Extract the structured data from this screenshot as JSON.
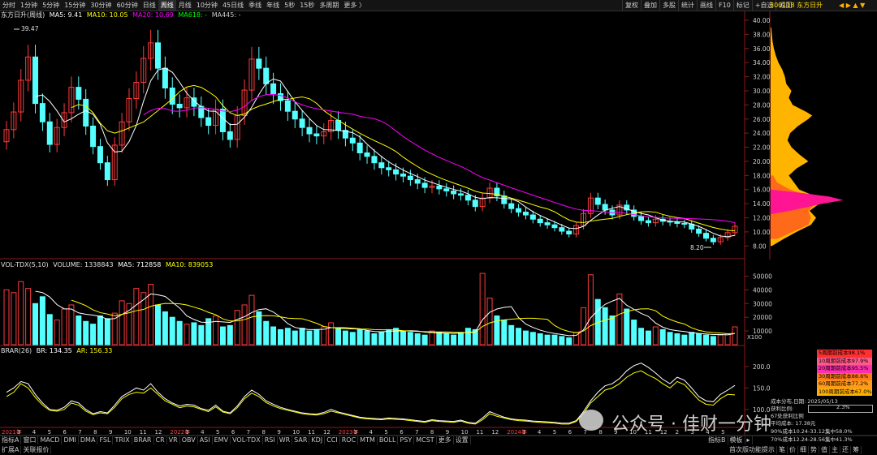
{
  "toolbar": {
    "tabs": [
      "分时",
      "1分钟",
      "5分钟",
      "15分钟",
      "30分钟",
      "60分钟",
      "日线",
      "周线",
      "月线",
      "10分钟",
      "45日线",
      "季线",
      "年线",
      "5秒",
      "15秒",
      "多周期",
      "更多 〉"
    ],
    "active_tab": "周线",
    "right_buttons": [
      "复权",
      "叠加",
      "多股",
      "统计",
      "画线",
      "F10",
      "标记",
      "+自选",
      "返回"
    ],
    "stock_code_name": "300118 东方日升"
  },
  "price_panel": {
    "label": "东方日升(周线)",
    "ma5": "MA5: 9.41",
    "ma10": "MA10: 10.05",
    "ma20": "MA20: 10.69",
    "ma618": "MA618: -",
    "ma445": "MA445: -",
    "high_label": "39.47",
    "low_label": "8.20",
    "y_ticks": [
      "40.00",
      "38.00",
      "36.00",
      "34.00",
      "32.00",
      "30.00",
      "28.00",
      "26.00",
      "24.00",
      "22.00",
      "20.00",
      "18.00",
      "16.00",
      "14.00",
      "12.00",
      "10.00",
      "8.00"
    ]
  },
  "volume_panel": {
    "label": "VOL-TDX(5,10)",
    "volume": "VOLUME: 1338843",
    "ma5": "MA5: 712858",
    "ma10": "MA10: 839053",
    "y_ticks": [
      "50000",
      "40000",
      "30000",
      "20000",
      "10000"
    ],
    "unit": "X100"
  },
  "brar_panel": {
    "label": "BRAR(26)",
    "br": "BR: 134.35",
    "ar": "AR: 156.33",
    "y_ticks": [
      "200.0",
      "150.0",
      "100.0"
    ]
  },
  "x_axis": {
    "labels": [
      "2021年",
      "3",
      "4",
      "5",
      "6",
      "7",
      "8",
      "9",
      "10",
      "11",
      "12",
      "2022年",
      "3",
      "4",
      "5",
      "6",
      "7",
      "8",
      "9",
      "10",
      "11",
      "12",
      "2023年",
      "3",
      "4",
      "5",
      "6",
      "7",
      "8",
      "9",
      "10",
      "11",
      "12",
      "2024年",
      "3",
      "4",
      "5",
      "6",
      "7",
      "8",
      "9",
      "10",
      "11",
      "12",
      "2",
      "3",
      "4",
      "5"
    ]
  },
  "indicator_tabs": [
    "指标A",
    "窗口",
    "MACD",
    "DMI",
    "DMA",
    "FSL",
    "TRIX",
    "BRAR",
    "CR",
    "VR",
    "OBV",
    "ASI",
    "EMV",
    "VOL-TDX",
    "RSI",
    "WR",
    "SAR",
    "KDJ",
    "CCI",
    "ROC",
    "MTM",
    "BOLL",
    "PSY",
    "MCST",
    "更多",
    "设置"
  ],
  "indicator_right": [
    "指标B",
    "模板",
    "▸"
  ],
  "bottom_bar": [
    "扩展A",
    "关联报价"
  ],
  "bottom_right": [
    "首次版功能提示",
    "笔",
    "价",
    "细",
    "势",
    "值",
    "主",
    "还",
    "筹"
  ],
  "cost_legend": [
    {
      "label": "5周期前成本98.1%",
      "color": "#ff3030"
    },
    {
      "label": "10周期前成本97.9%",
      "color": "#ff5a8a"
    },
    {
      "label": "20周期前成本95.5%",
      "color": "#ff2fb0"
    },
    {
      "label": "30周期前成本88.6%",
      "color": "#ff7a1a"
    },
    {
      "label": "60周期前成本77.2%",
      "color": "#ff9a1a"
    },
    {
      "label": "100周期前成本67.0%",
      "color": "#ffb000"
    }
  ],
  "chip_stats": {
    "line1": "成本分布,日期: 2025/05/13",
    "line2": "获利比例:",
    "line2_val": "2.3%",
    "line3": "67处获利比例",
    "line4": "平均成本: 17.38元",
    "line5": "90%成本10.24-33.12集中58.0%",
    "line6": "70%成本12.24-28.56集中41.3%"
  },
  "watermark": "公众号 · 佳财一分钟",
  "colors": {
    "up": "#ff3b3b",
    "down": "#54ffff",
    "ma5": "#ffffff",
    "ma10": "#ffff00",
    "ma20": "#ff00ff",
    "chip": "#ffb400"
  },
  "chart_data": {
    "type": "candlestick",
    "close": [
      24.5,
      27.0,
      31.5,
      34.8,
      28.2,
      25.6,
      22.4,
      24.8,
      26.9,
      30.5,
      28.8,
      25.0,
      22.1,
      19.8,
      17.4,
      22.3,
      25.6,
      28.9,
      31.2,
      34.6,
      36.8,
      33.2,
      30.4,
      28.1,
      27.6,
      29.0,
      27.8,
      26.2,
      25.1,
      27.4,
      24.2,
      23.1,
      26.5,
      30.1,
      34.5,
      33.2,
      31.0,
      29.6,
      28.6,
      27.1,
      26.0,
      24.8,
      23.9,
      23.6,
      24.2,
      25.8,
      24.4,
      23.3,
      22.6,
      21.2,
      20.7,
      19.8,
      19.1,
      18.8,
      18.2,
      17.9,
      17.4,
      16.9,
      16.3,
      16.5,
      16.1,
      15.8,
      15.4,
      15.2,
      14.5,
      13.6,
      14.8,
      16.2,
      15.1,
      14.0,
      13.3,
      12.8,
      12.4,
      11.8,
      11.3,
      11.0,
      10.6,
      10.1,
      9.7,
      10.9,
      12.6,
      14.8,
      13.9,
      13.1,
      12.4,
      13.8,
      13.1,
      12.2,
      11.6,
      11.3,
      11.8,
      11.5,
      11.4,
      11.2,
      11.1,
      10.4,
      9.8,
      9.1,
      8.6,
      9.2,
      9.9,
      10.8
    ],
    "volume": [
      40000,
      38000,
      46000,
      41000,
      30000,
      35000,
      22000,
      18000,
      26000,
      29000,
      21000,
      17000,
      15000,
      21000,
      19000,
      23000,
      32000,
      30000,
      41000,
      38000,
      44000,
      29000,
      24000,
      20000,
      17000,
      15000,
      16000,
      14000,
      19000,
      21000,
      13000,
      14000,
      25000,
      29000,
      36000,
      24000,
      17000,
      13000,
      11000,
      12000,
      10000,
      12000,
      10000,
      11000,
      13000,
      16000,
      12000,
      10000,
      9000,
      11000,
      10000,
      8000,
      9000,
      11000,
      12000,
      10000,
      9000,
      8000,
      7000,
      10000,
      9000,
      8000,
      7000,
      9000,
      12000,
      11000,
      52000,
      34000,
      21000,
      18000,
      14000,
      12000,
      10000,
      9000,
      8000,
      7000,
      7000,
      6000,
      5000,
      9000,
      27000,
      51000,
      33000,
      27000,
      21000,
      37000,
      26000,
      18000,
      12000,
      10000,
      13000,
      11000,
      9000,
      8000,
      7000,
      9000,
      8000,
      7000,
      6000,
      7000,
      8000,
      13000
    ],
    "brar_br": [
      140,
      150,
      165,
      160,
      135,
      115,
      100,
      98,
      105,
      120,
      115,
      100,
      90,
      95,
      92,
      110,
      130,
      140,
      150,
      145,
      160,
      140,
      125,
      115,
      108,
      112,
      110,
      102,
      98,
      110,
      96,
      92,
      108,
      130,
      145,
      135,
      120,
      112,
      105,
      100,
      96,
      92,
      90,
      89,
      93,
      100,
      94,
      90,
      86,
      82,
      80,
      79,
      78,
      80,
      79,
      78,
      76,
      74,
      72,
      76,
      74,
      73,
      72,
      75,
      70,
      68,
      80,
      95,
      88,
      82,
      78,
      76,
      75,
      73,
      72,
      71,
      70,
      68,
      68,
      74,
      95,
      120,
      140,
      155,
      160,
      172,
      190,
      202,
      208,
      198,
      185,
      170,
      160,
      175,
      168,
      150,
      130,
      120,
      118,
      135,
      145,
      156
    ],
    "brar_ar": [
      130,
      140,
      160,
      150,
      128,
      110,
      98,
      96,
      100,
      115,
      110,
      96,
      88,
      92,
      90,
      105,
      125,
      135,
      140,
      138,
      150,
      135,
      120,
      112,
      104,
      108,
      106,
      100,
      95,
      106,
      94,
      90,
      104,
      125,
      138,
      130,
      116,
      108,
      102,
      98,
      94,
      90,
      88,
      87,
      90,
      96,
      92,
      88,
      84,
      80,
      78,
      77,
      76,
      78,
      77,
      76,
      74,
      72,
      70,
      74,
      72,
      71,
      70,
      73,
      68,
      66,
      76,
      90,
      84,
      80,
      76,
      74,
      73,
      71,
      70,
      69,
      68,
      66,
      66,
      72,
      90,
      115,
      130,
      145,
      150,
      160,
      175,
      185,
      190,
      180,
      172,
      160,
      150,
      165,
      158,
      140,
      122,
      112,
      110,
      125,
      135,
      134
    ]
  }
}
